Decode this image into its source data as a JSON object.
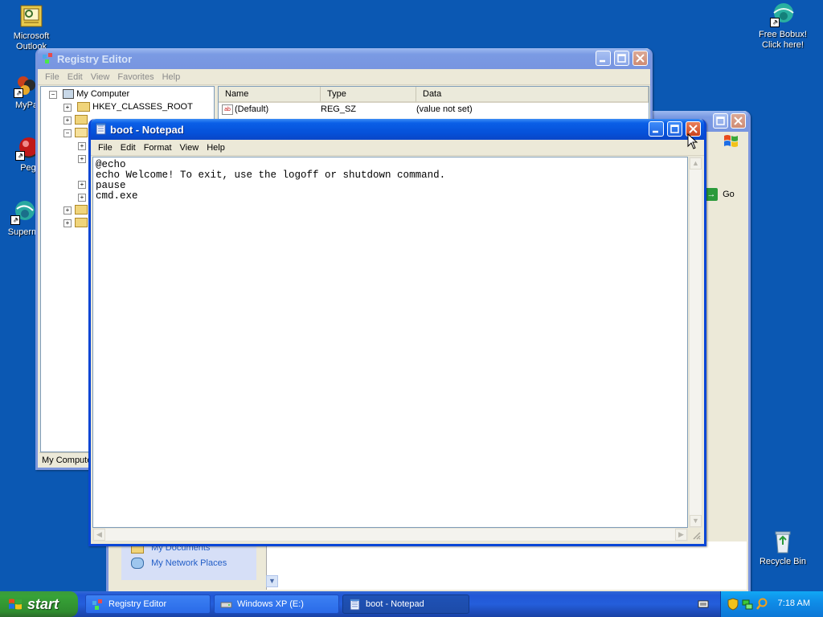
{
  "desktop_icons": [
    {
      "label_lines": [
        "Microsoft",
        "Outlook"
      ],
      "icon": "outlook-icon"
    },
    {
      "label_lines": [
        "MyPa"
      ],
      "icon": "mypal-icon"
    },
    {
      "label_lines": [
        "Peg"
      ],
      "icon": "pegasus-icon"
    },
    {
      "label_lines": [
        "Superm"
      ],
      "icon": "superm-icon"
    },
    {
      "label_lines": [
        "Free Bobux!",
        "Click here!"
      ],
      "icon": "ie-globe-icon"
    },
    {
      "label_lines": [
        "Recycle Bin"
      ],
      "icon": "recycle-bin-icon"
    }
  ],
  "registry_editor": {
    "title": "Registry Editor",
    "menu": [
      "File",
      "Edit",
      "View",
      "Favorites",
      "Help"
    ],
    "tree_root": "My Computer",
    "tree_first": "HKEY_CLASSES_ROOT",
    "columns": [
      "Name",
      "Type",
      "Data"
    ],
    "row": {
      "name": "(Default)",
      "type": "REG_SZ",
      "data": "(value not set)"
    },
    "status": "My Compute"
  },
  "explorer_window": {
    "go_label": "Go",
    "links": [
      "My Documents",
      "My Network Places"
    ]
  },
  "notepad": {
    "title": "boot - Notepad",
    "menu": [
      "File",
      "Edit",
      "Format",
      "View",
      "Help"
    ],
    "content": "@echo\necho Welcome! To exit, use the logoff or shutdown command.\npause\ncmd.exe"
  },
  "taskbar": {
    "start_label": "start",
    "items": [
      {
        "label": "Registry Editor",
        "icon": "regedit-icon",
        "active": false
      },
      {
        "label": "Windows XP (E:)",
        "icon": "drive-icon",
        "active": false
      },
      {
        "label": "boot - Notepad",
        "icon": "notepad-icon",
        "active": true
      }
    ],
    "clock": "7:18 AM"
  },
  "colors": {
    "desktop": "#0b58b3",
    "title_active": "#0550d8",
    "title_inactive": "#7895e0",
    "start_green": "#37a237",
    "tray_blue": "#0f8de8"
  }
}
